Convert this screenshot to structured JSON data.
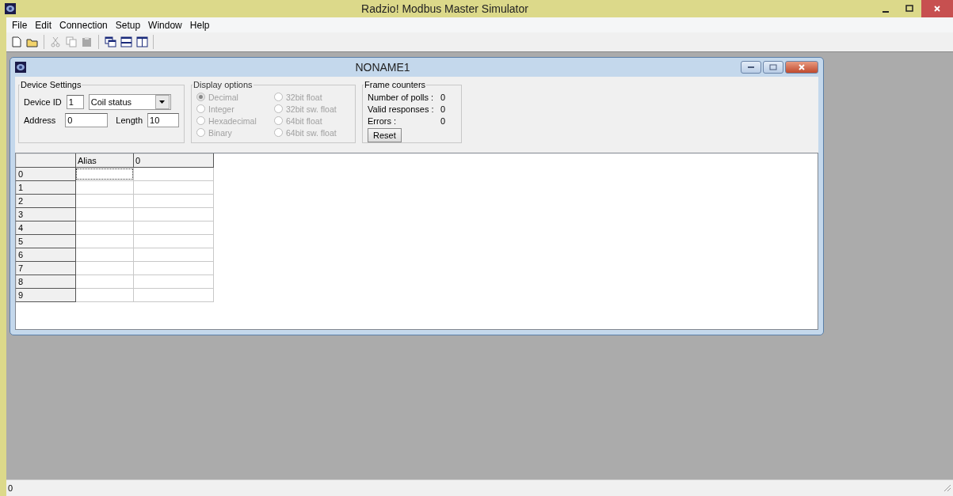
{
  "window": {
    "title": "Radzio! Modbus Master Simulator"
  },
  "menu": [
    "File",
    "Edit",
    "Connection",
    "Setup",
    "Window",
    "Help"
  ],
  "toolbar": [
    {
      "kind": "new",
      "disabled": false
    },
    {
      "kind": "open",
      "disabled": false
    },
    {
      "kind": "sep"
    },
    {
      "kind": "cut",
      "disabled": true
    },
    {
      "kind": "copy",
      "disabled": true
    },
    {
      "kind": "paste",
      "disabled": true
    },
    {
      "kind": "sep"
    },
    {
      "kind": "cascade",
      "disabled": false
    },
    {
      "kind": "tileh",
      "disabled": false
    },
    {
      "kind": "tilev",
      "disabled": false
    },
    {
      "kind": "sep"
    }
  ],
  "child": {
    "title": "NONAME1",
    "device_settings": {
      "legend": "Device Settings",
      "device_id_label": "Device ID",
      "device_id": "1",
      "function": "Coil status",
      "address_label": "Address",
      "address": "0",
      "length_label": "Length",
      "length": "10"
    },
    "display_options": {
      "legend": "Display options",
      "disabled": true,
      "options": [
        {
          "label": "Decimal",
          "selected": true
        },
        {
          "label": "Integer",
          "selected": false
        },
        {
          "label": "Hexadecimal",
          "selected": false
        },
        {
          "label": "Binary",
          "selected": false
        },
        {
          "label": "32bit float",
          "selected": false
        },
        {
          "label": "32bit sw. float",
          "selected": false
        },
        {
          "label": "64bit float",
          "selected": false
        },
        {
          "label": "64bit sw. float",
          "selected": false
        }
      ]
    },
    "frame_counters": {
      "legend": "Frame counters",
      "rows": [
        {
          "label": "Number of polls :",
          "value": "0"
        },
        {
          "label": "Valid responses :",
          "value": "0"
        },
        {
          "label": "Errors :",
          "value": "0"
        }
      ],
      "reset": "Reset"
    },
    "table": {
      "columns": [
        "Alias",
        "0"
      ],
      "rows": [
        {
          "header": "0",
          "focused": true
        },
        {
          "header": "1",
          "focused": false
        },
        {
          "header": "2",
          "focused": false
        },
        {
          "header": "3",
          "focused": false
        },
        {
          "header": "4",
          "focused": false
        },
        {
          "header": "5",
          "focused": false
        },
        {
          "header": "6",
          "focused": false
        },
        {
          "header": "7",
          "focused": false
        },
        {
          "header": "8",
          "focused": false
        },
        {
          "header": "9",
          "focused": false
        }
      ]
    }
  },
  "status_bar": "0"
}
